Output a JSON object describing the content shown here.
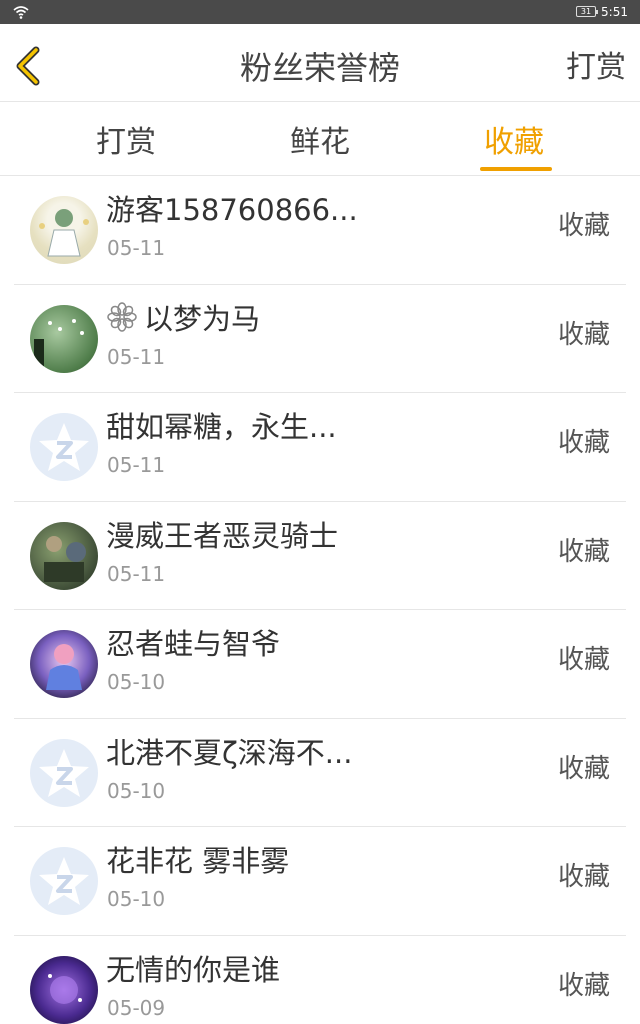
{
  "status_bar": {
    "time": "5:51",
    "battery": "31"
  },
  "nav": {
    "title": "粉丝荣誉榜",
    "right_action": "打赏"
  },
  "tabs": [
    {
      "label": "打赏",
      "active": false
    },
    {
      "label": "鲜花",
      "active": false
    },
    {
      "label": "收藏",
      "active": true
    }
  ],
  "accent_color": "#f0a000",
  "rows": [
    {
      "name": "游客158760866...",
      "date": "05-11",
      "action": "收藏",
      "avatar": "anime-girl-avatar"
    },
    {
      "name": "以梦为马",
      "date": "05-11",
      "action": "收藏",
      "avatar": "nature-photo-avatar"
    },
    {
      "name": "甜如幂糖，永生...",
      "date": "05-11",
      "action": "收藏",
      "avatar": "default-star-avatar"
    },
    {
      "name": "漫威王者恶灵骑士",
      "date": "05-11",
      "action": "收藏",
      "avatar": "game-art-avatar"
    },
    {
      "name": "忍者蛙与智爷",
      "date": "05-10",
      "action": "收藏",
      "avatar": "anime-art-avatar"
    },
    {
      "name": "北港不夏ζ深海不...",
      "date": "05-10",
      "action": "收藏",
      "avatar": "default-star-avatar"
    },
    {
      "name": "花非花 雾非雾",
      "date": "05-10",
      "action": "收藏",
      "avatar": "default-star-avatar"
    },
    {
      "name": "无情的你是谁",
      "date": "05-09",
      "action": "收藏",
      "avatar": "galaxy-art-avatar"
    }
  ]
}
